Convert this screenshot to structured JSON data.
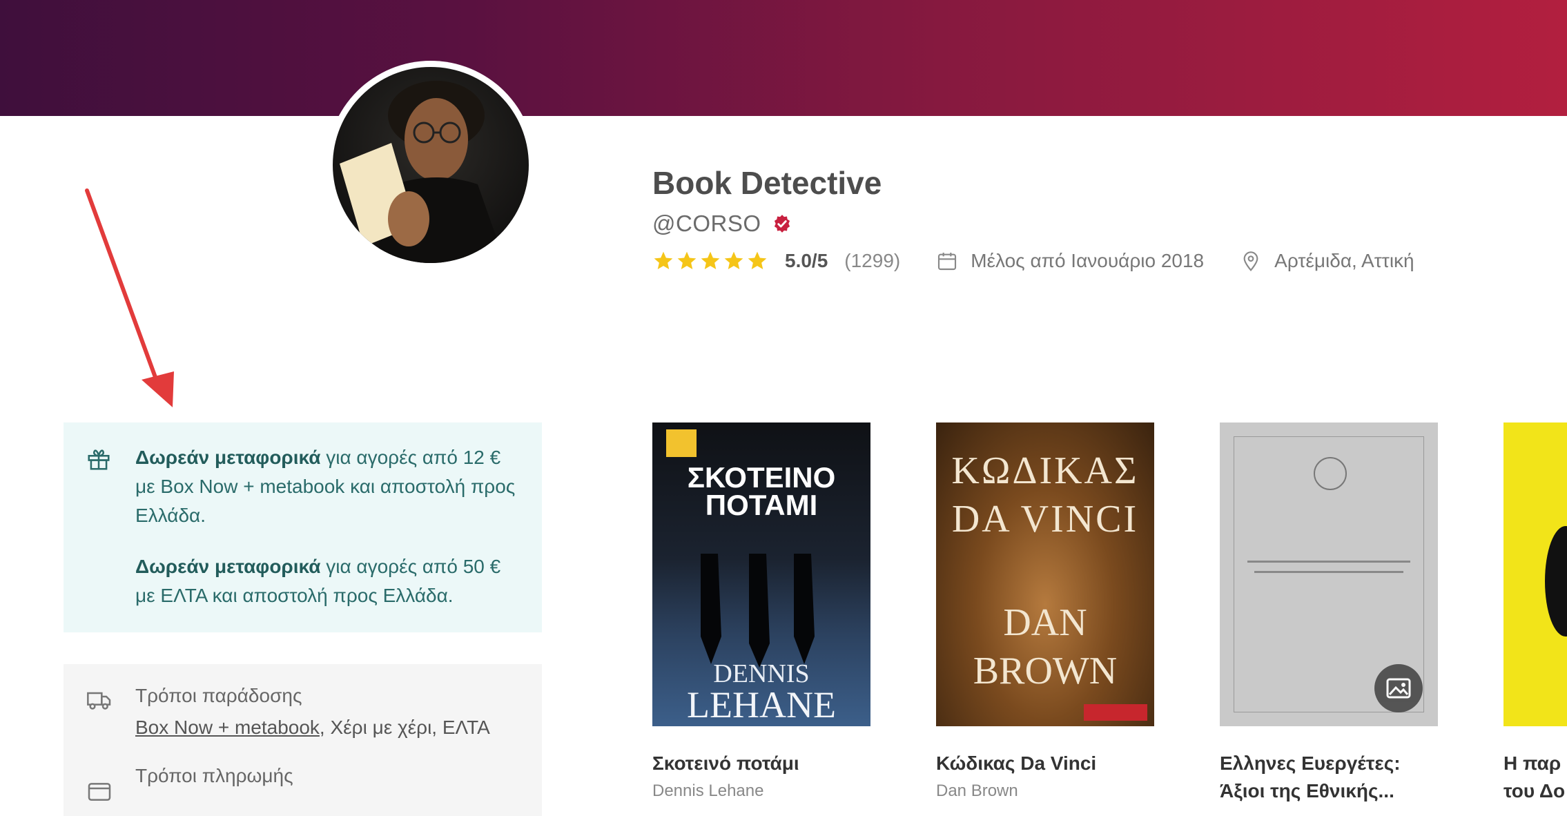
{
  "profile": {
    "name": "Book Detective",
    "handle": "@CORSO",
    "rating": "5.0/5",
    "reviews_count": "(1299)",
    "member_since": "Μέλος από Ιανουάριο 2018",
    "location": "Αρτέμιδα, Αττική",
    "stars": 5,
    "icons": {
      "verified": "verified-badge-icon",
      "calendar": "calendar-icon",
      "location": "location-pin-icon"
    }
  },
  "promo": {
    "line1_bold": "Δωρεάν μεταφορικά",
    "line1_rest": " για αγορές από 12 € με Box Now + metabook και αποστολή προς Ελλάδα.",
    "line2_bold": "Δωρεάν μεταφορικά",
    "line2_rest": " για αγορές από 50 € με ΕΛΤΑ και αποστολή προς Ελλάδα."
  },
  "delivery": {
    "title": "Τρόποι παράδοσης",
    "values_link": "Box Now + metabook",
    "values_rest": ", Χέρι με χέρι, ΕΛΤΑ",
    "payment_title": "Τρόποι πληρωμής"
  },
  "books": [
    {
      "title": "Σκοτεινό ποτάμι",
      "author": "Dennis Lehane",
      "cover_top": "ΣΚΟΤΕΙΝΟ ΠΟΤΑΜΙ",
      "cover_author1": "DENNIS",
      "cover_author2": "LEHANE"
    },
    {
      "title": "Κώδικας Da Vinci",
      "author": "Dan Brown",
      "cover_top1": "ΚΩΔΙΚΑΣ",
      "cover_top2": "DA VINCI",
      "cover_author1": "DAN",
      "cover_author2": "BROWN"
    },
    {
      "title": "Ελληνες Ευεργέτες:",
      "title2": "Άξιοι της Εθνικής...",
      "author": ""
    },
    {
      "title": "Η παρ",
      "title2": "του Δο",
      "author": ""
    }
  ],
  "colors": {
    "banner_start": "#3f0f3c",
    "banner_end": "#b21f3f",
    "star": "#f5c518",
    "verified": "#c8203f",
    "promo_bg": "#ecf8f8",
    "promo_text": "#2a6b6a",
    "arrow": "#e23b3b"
  }
}
